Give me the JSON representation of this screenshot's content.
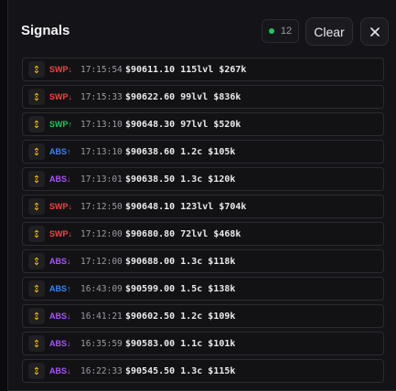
{
  "header": {
    "title": "Signals",
    "count": "12",
    "clear_label": "Clear",
    "close_icon": "close-icon"
  },
  "colors": {
    "SWP↓": "#ef4444",
    "SWP↑": "#22c55e",
    "ABS↑": "#3b82f6",
    "ABS↓": "#a855f7",
    "icon": "#f0b90b",
    "live": "#22c55e"
  },
  "signals": [
    {
      "type": "SWP↓",
      "time": "17:15:54",
      "detail": "$90611.10 115lvl $267k"
    },
    {
      "type": "SWP↓",
      "time": "17:15:33",
      "detail": "$90622.60 99lvl $836k"
    },
    {
      "type": "SWP↑",
      "time": "17:13:10",
      "detail": "$90648.30 97lvl $520k"
    },
    {
      "type": "ABS↑",
      "time": "17:13:10",
      "detail": "$90638.60 1.2c $105k"
    },
    {
      "type": "ABS↓",
      "time": "17:13:01",
      "detail": "$90638.50 1.3c $120k"
    },
    {
      "type": "SWP↓",
      "time": "17:12:50",
      "detail": "$90648.10 123lvl $704k"
    },
    {
      "type": "SWP↓",
      "time": "17:12:00",
      "detail": "$90680.80 72lvl $468k"
    },
    {
      "type": "ABS↓",
      "time": "17:12:00",
      "detail": "$90688.00 1.3c $118k"
    },
    {
      "type": "ABS↑",
      "time": "16:43:09",
      "detail": "$90599.00 1.5c $138k"
    },
    {
      "type": "ABS↓",
      "time": "16:41:21",
      "detail": "$90602.50 1.2c $109k"
    },
    {
      "type": "ABS↓",
      "time": "16:35:59",
      "detail": "$90583.00 1.1c $101k"
    },
    {
      "type": "ABS↓",
      "time": "16:22:33",
      "detail": "$90545.50 1.3c $115k"
    }
  ]
}
